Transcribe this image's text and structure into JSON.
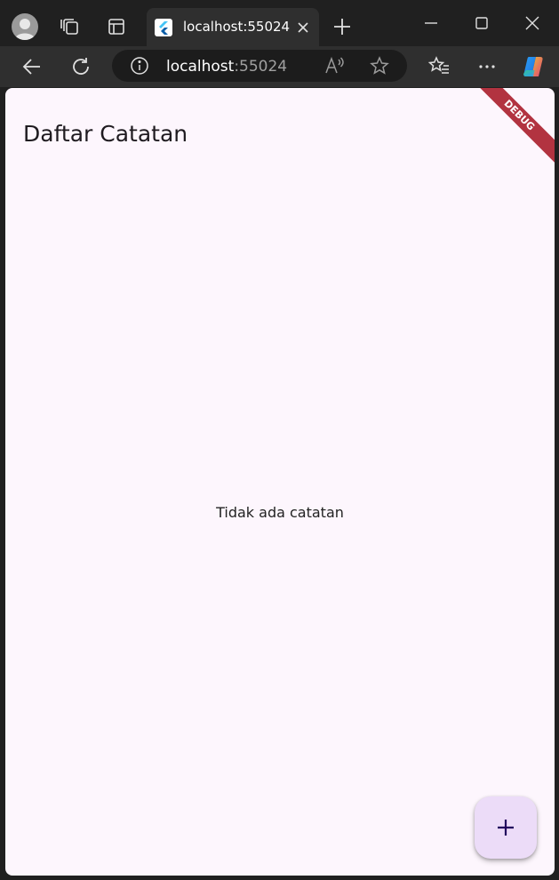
{
  "browser": {
    "tab_title": "localhost:55024",
    "address": {
      "host": "localhost",
      "port": ":55024"
    }
  },
  "app": {
    "title": "Daftar Catatan",
    "empty_message": "Tidak ada catatan",
    "debug_banner": "DEBUG",
    "fab_icon": "add-icon"
  },
  "colors": {
    "page_background": "#fdf6fd",
    "fab_background": "#ecdcf8",
    "debug_banner": "#b23340"
  }
}
